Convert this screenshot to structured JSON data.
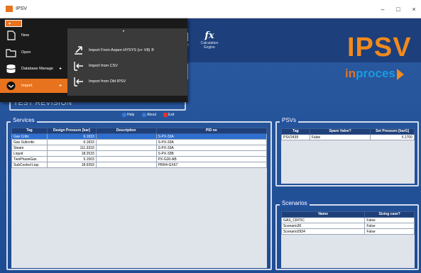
{
  "window": {
    "title": "IPSV",
    "minimize": "–",
    "maximize": "□",
    "close": "×"
  },
  "ribbon": {
    "table_label": "Tablet",
    "calc_symbol": "fx",
    "calc_label_1": "Calculation",
    "calc_label_2": "Engine"
  },
  "logo": {
    "main": "IPSV",
    "sub_a": "in",
    "sub_b": "proces"
  },
  "revision": {
    "label": "TEST REVISION"
  },
  "services": {
    "legend": "Services",
    "columns": [
      "Tag",
      "Design Pressure [bar]",
      "Description",
      "PID no"
    ],
    "rows": [
      {
        "tag": "Gas Critic",
        "pressure": "6.1833",
        "description": "",
        "pid": "S-PX-33A",
        "selected": true
      },
      {
        "tag": "Gas Subcritic",
        "pressure": "6.1833",
        "description": "",
        "pid": "S-PX-33A"
      },
      {
        "tag": "Steam",
        "pressure": "111.3333",
        "description": "",
        "pid": "S-PX-33A"
      },
      {
        "tag": "Liquid",
        "pressure": "18.2533",
        "description": "",
        "pid": "S-PX-33B"
      },
      {
        "tag": "TwoPhaseGas",
        "pressure": "5.1503",
        "description": "",
        "pid": "PX-G30-AB"
      },
      {
        "tag": "SubCooled Liqu",
        "pressure": "18.9393",
        "description": "",
        "pid": "PRR4-GX67"
      }
    ]
  },
  "psvs": {
    "legend": "PSVs",
    "columns": [
      "Tag",
      "Spare Valve?",
      "Set Pressure [barG]"
    ],
    "rows": [
      {
        "tag": "PSV2439",
        "spare": "False",
        "set_pressure": "5.1700"
      }
    ]
  },
  "scenarios": {
    "legend": "Scenarios",
    "columns": [
      "Name",
      "Sizing case?"
    ],
    "rows": [
      {
        "name": "GAS_CRITIC",
        "sizing": "False"
      },
      {
        "name": "Scenario30",
        "sizing": "False"
      },
      {
        "name": "Scenario2934",
        "sizing": "False"
      }
    ]
  },
  "menu": {
    "left_items": [
      {
        "label": "New",
        "icon": "new-file-icon"
      },
      {
        "label": "Open",
        "icon": "folder-open-icon"
      },
      {
        "label": "Database Manage",
        "icon": "database-icon",
        "chevron": "▸"
      },
      {
        "label": "Import",
        "icon": "import-icon",
        "chevron": "▸",
        "active": true
      }
    ],
    "right_items": [
      {
        "label": "Import From Aspen HYSYS (v+ V8) ®",
        "icon": "import-hysys-icon"
      },
      {
        "label": "Import from CSV",
        "icon": "import-csv-icon"
      },
      {
        "label": "Import from Old IPSV",
        "icon": "import-old-icon"
      }
    ],
    "footer": {
      "help": "Help",
      "about": "About",
      "exit": "Exit"
    },
    "dot": "•"
  },
  "colors": {
    "accent": "#e8731e",
    "brand_blue": "#1b9be0",
    "background": "#2452a0",
    "selected_row": "#2e6fd1"
  }
}
